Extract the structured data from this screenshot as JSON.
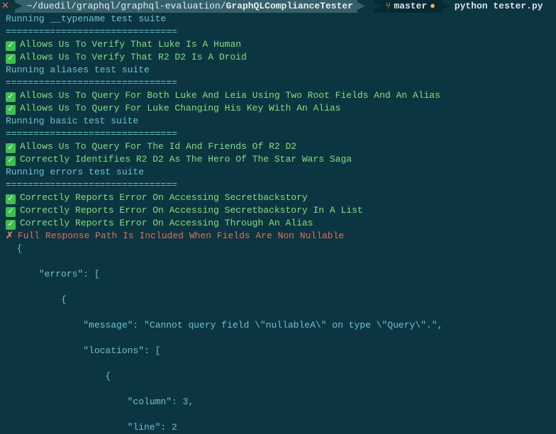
{
  "topbar": {
    "path_prefix": "~/duedil/graphql/graphql-evaluation/",
    "path_folder": "GraphQLComplianceTester",
    "branch": "master",
    "command": "python tester.py"
  },
  "suites": [
    {
      "title": "Running __typename test suite",
      "tests": [
        {
          "status": "pass",
          "label": "Allows Us To Verify That Luke Is A Human"
        },
        {
          "status": "pass",
          "label": "Allows Us To Verify That R2 D2 Is A Droid"
        }
      ]
    },
    {
      "title": "Running aliases test suite",
      "tests": [
        {
          "status": "pass",
          "label": "Allows Us To Query For Both Luke And Leia Using Two Root Fields And An Alias"
        },
        {
          "status": "pass",
          "label": "Allows Us To Query For Luke Changing His Key With An Alias"
        }
      ]
    },
    {
      "title": "Running basic test suite",
      "tests": [
        {
          "status": "pass",
          "label": "Allows Us To Query For The Id And Friends Of R2 D2"
        },
        {
          "status": "pass",
          "label": "Correctly Identifies R2 D2 As The Hero Of The Star Wars Saga"
        }
      ]
    },
    {
      "title": "Running errors test suite",
      "tests": [
        {
          "status": "pass",
          "label": "Correctly Reports Error On Accessing Secretbackstory"
        },
        {
          "status": "pass",
          "label": "Correctly Reports Error On Accessing Secretbackstory In A List"
        },
        {
          "status": "pass",
          "label": "Correctly Reports Error On Accessing Through An Alias"
        },
        {
          "status": "fail",
          "label": "Full Response Path Is Included When Fields Are Non Nullable"
        }
      ]
    }
  ],
  "divider": "===============================",
  "json_lines": [
    "  {",
    "",
    "      \"errors\": [",
    "",
    "          {",
    "",
    "              \"message\": \"Cannot query field \\\"nullableA\\\" on type \\\"Query\\\".\",",
    "",
    "              \"locations\": [",
    "",
    "                  {",
    "",
    "                      \"column\": 3,",
    "",
    "                      \"line\": 2"
  ]
}
